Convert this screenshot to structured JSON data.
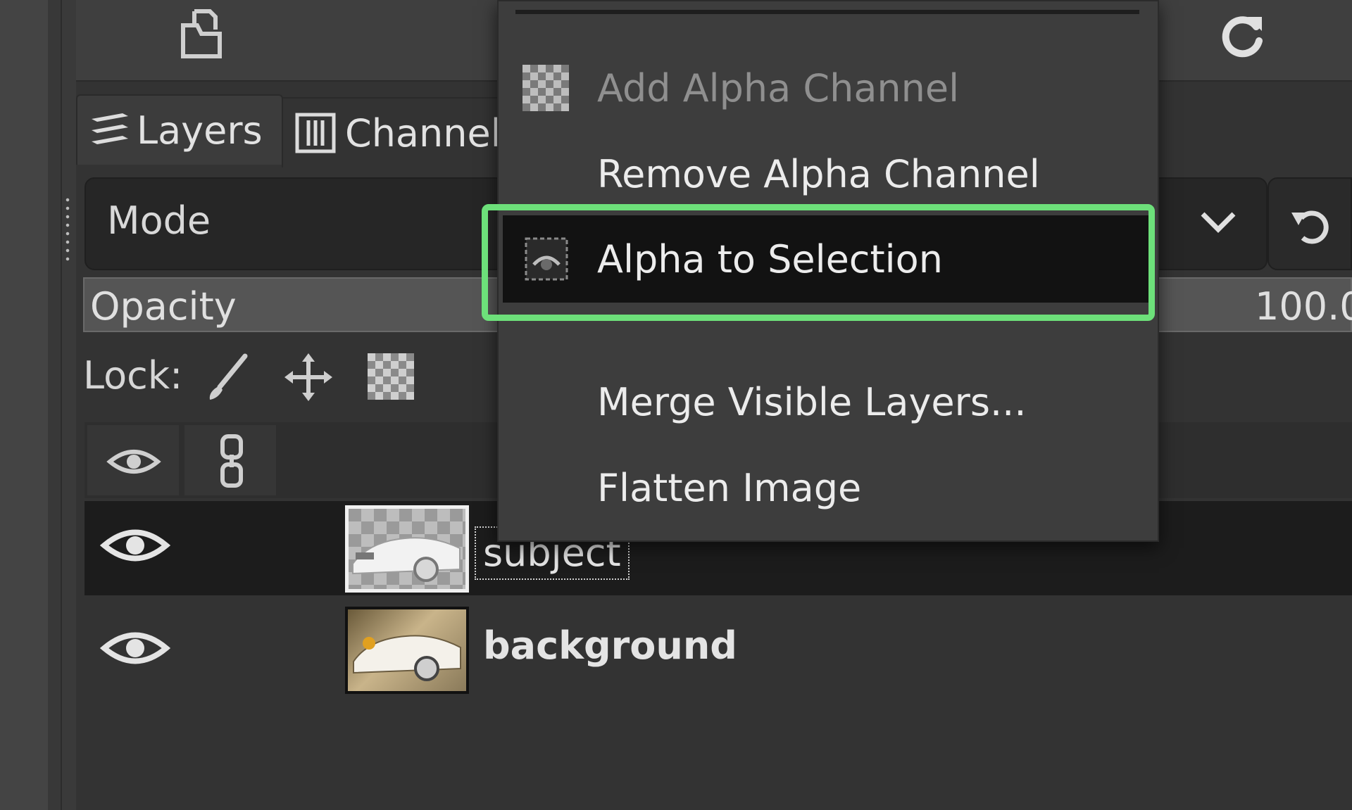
{
  "tabs": {
    "layers": "Layers",
    "channels": "Channel"
  },
  "mode": {
    "label": "Mode"
  },
  "opacity": {
    "label": "Opacity",
    "value": "100.0"
  },
  "lock": {
    "label": "Lock:"
  },
  "layers": [
    {
      "name": "subject",
      "visible": true,
      "selected": true
    },
    {
      "name": "background",
      "visible": true,
      "selected": false
    }
  ],
  "context_menu": {
    "items": [
      {
        "label": "Add Alpha Channel",
        "enabled": false,
        "icon": "checkerboard-icon"
      },
      {
        "label": "Remove Alpha Channel",
        "enabled": true
      },
      {
        "label": "Alpha to Selection",
        "enabled": true,
        "highlighted": true,
        "icon": "alpha-selection-icon"
      },
      {
        "label": "Merge Visible Layers...",
        "enabled": true
      },
      {
        "label": "Flatten Image",
        "enabled": true
      }
    ]
  },
  "colors": {
    "highlight_border": "#6de07a",
    "selected_item_bg": "#121212",
    "panel_bg": "#333333"
  }
}
